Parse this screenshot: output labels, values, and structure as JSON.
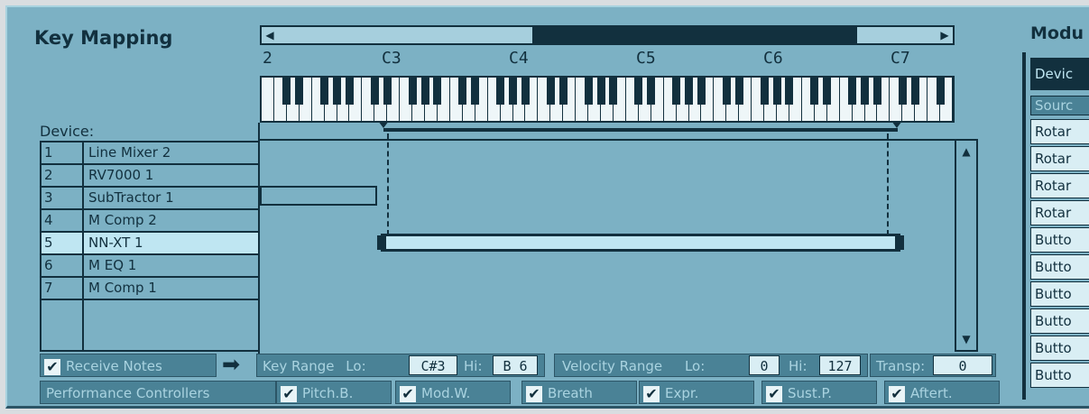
{
  "key_mapping": {
    "title": "Key Mapping",
    "octave_labels": [
      "2",
      "C3",
      "C4",
      "C5",
      "C6",
      "C7"
    ],
    "device_label": "Device:",
    "devices": [
      {
        "num": "1",
        "name": "Line Mixer 2"
      },
      {
        "num": "2",
        "name": "RV7000 1"
      },
      {
        "num": "3",
        "name": "SubTractor 1"
      },
      {
        "num": "4",
        "name": "M Comp 2"
      },
      {
        "num": "5",
        "name": "NN-XT 1"
      },
      {
        "num": "6",
        "name": "M EQ 1"
      },
      {
        "num": "7",
        "name": "M Comp 1"
      }
    ],
    "selected_device_index": 4
  },
  "controls": {
    "receive_notes": "Receive Notes",
    "key_range_label": "Key Range",
    "lo_label": "Lo:",
    "hi_label": "Hi:",
    "key_lo": "C#3",
    "key_hi": "B 6",
    "velocity_range_label": "Velocity Range",
    "vel_lo": "0",
    "vel_hi": "127",
    "transpose_label": "Transp:",
    "transpose_value": "0",
    "performance_label": "Performance Controllers",
    "pitch": "Pitch.B.",
    "mod": "Mod.W.",
    "breath": "Breath",
    "expr": "Expr.",
    "sust": "Sust.P.",
    "aftert": "Aftert."
  },
  "modulation": {
    "title": "Modu",
    "header": "Devic",
    "source_header": "Sourc",
    "items": [
      "Rotar",
      "Rotar",
      "Rotar",
      "Rotar",
      "Butto",
      "Butto",
      "Butto",
      "Butto",
      "Butto",
      "Butto"
    ]
  },
  "icons": {
    "check": "✔",
    "arrow": "➡",
    "left": "◀",
    "right": "▶",
    "up": "▲",
    "down": "▼"
  },
  "colors": {
    "panel": "#7cb1c4",
    "dark": "#12303e",
    "selection": "#bfe6f2"
  }
}
